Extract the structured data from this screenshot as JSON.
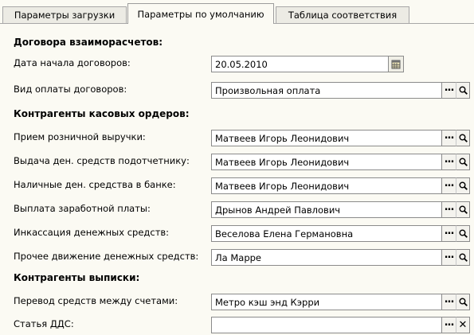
{
  "tabs": [
    {
      "label": "Параметры загрузки",
      "active": false
    },
    {
      "label": "Параметры по умолчанию",
      "active": true
    },
    {
      "label": "Таблица соответствия",
      "active": false
    }
  ],
  "sections": {
    "contracts": "Договора взаиморасчетов:",
    "cash_orders": "Контрагенты касовых ордеров:",
    "statement": "Контрагенты выписки:"
  },
  "contracts": {
    "start_date": {
      "label": "Дата начала договоров:",
      "value": "20.05.2010"
    },
    "payment_type": {
      "label": "Вид оплаты договоров:",
      "value": "Произвольная оплата"
    }
  },
  "cash_orders": [
    {
      "label": "Прием розничной выручки:",
      "value": "Матвеев Игорь Леонидович"
    },
    {
      "label": "Выдача ден. средств подотчетнику:",
      "value": "Матвеев Игорь Леонидович"
    },
    {
      "label": "Наличные ден. средства в банке:",
      "value": "Матвеев Игорь Леонидович"
    },
    {
      "label": "Выплата заработной платы:",
      "value": "Дрынов Андрей Павлович"
    },
    {
      "label": "Инкассация денежных средств:",
      "value": "Веселова Елена Германовна"
    },
    {
      "label": "Прочее движение денежных средств:",
      "value": "Ла Марре"
    }
  ],
  "statement": [
    {
      "label": "Перевод средств между счетами:",
      "value": "Метро кэш энд Кэрри"
    },
    {
      "label": "Статья ДДС:",
      "value": ""
    }
  ],
  "icons": {
    "select": "ellipsis-icon",
    "open": "magnifier-icon",
    "clear": "clear-x-icon",
    "calendar": "calendar-icon"
  }
}
